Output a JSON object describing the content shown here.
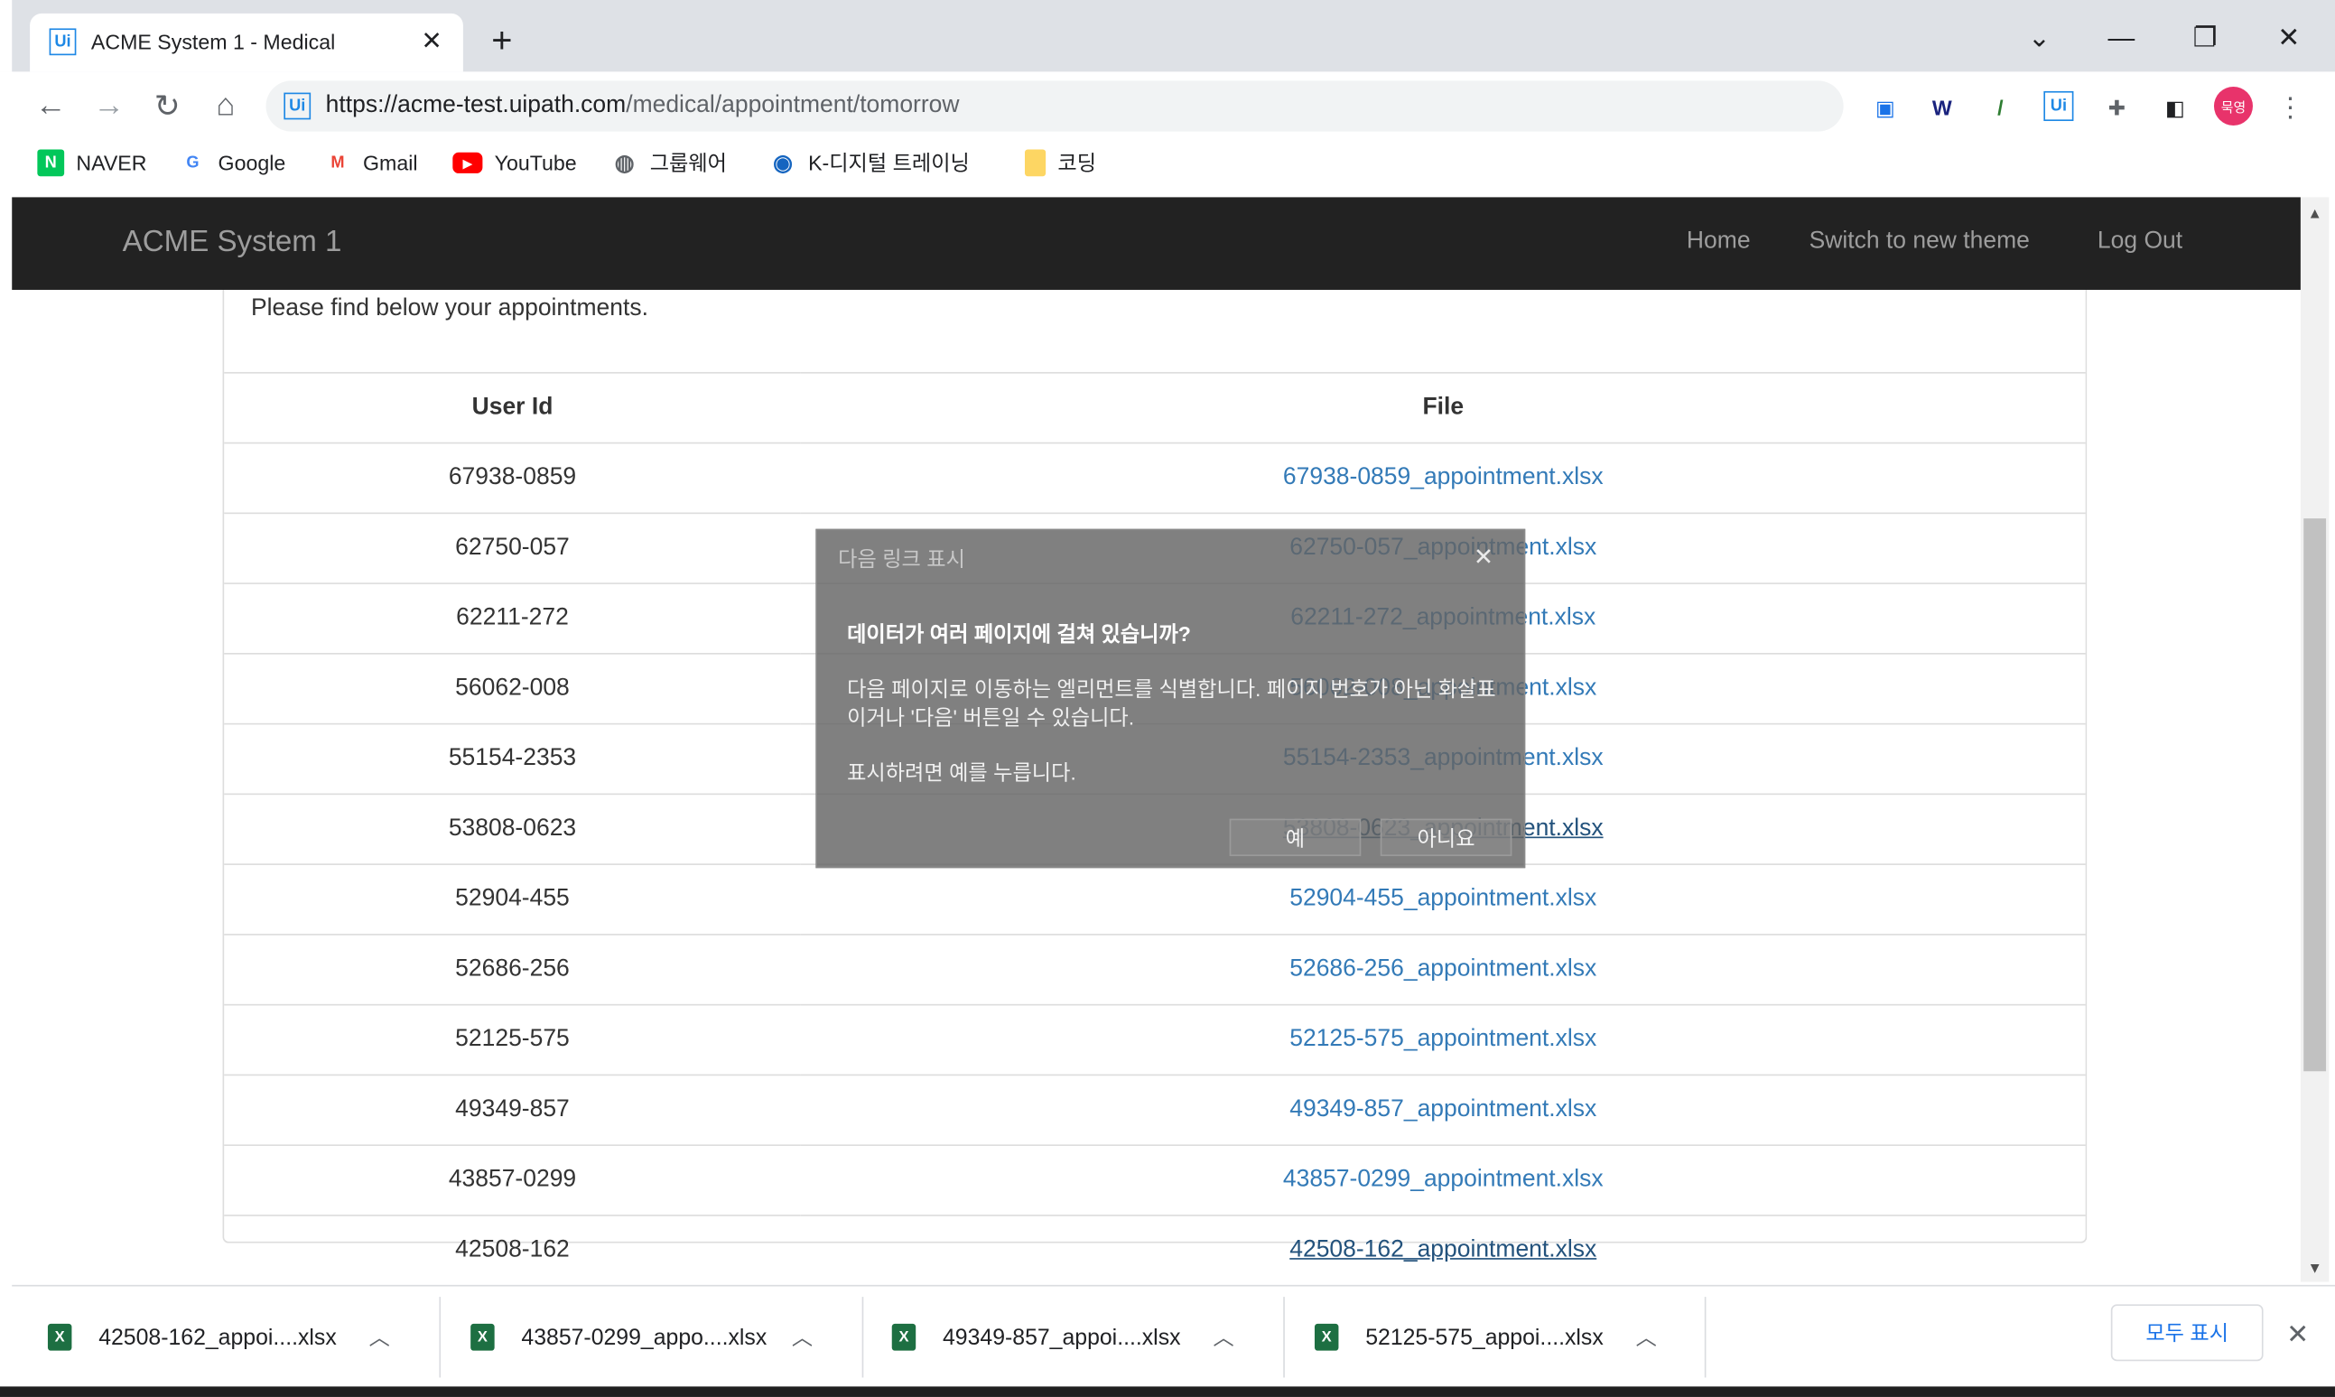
{
  "browser": {
    "tab_title": "ACME System 1 - Medical",
    "new_tab": "+",
    "url_host": "https://acme-test.uipath.com",
    "url_path": "/medical/appointment/tomorrow",
    "profile_label": "묵영",
    "bookmarks": [
      "NAVER",
      "Google",
      "Gmail",
      "YouTube",
      "그룹웨어",
      "K-디지털 트레이닝",
      "코딩"
    ]
  },
  "app": {
    "brand": "ACME System 1",
    "nav": [
      "Home",
      "Switch to new theme",
      "Log Out"
    ],
    "intro": "Please find below your appointments.",
    "table": {
      "headers": [
        "User Id",
        "File"
      ],
      "rows": [
        {
          "id": "67938-0859",
          "file": "67938-0859_appointment.xlsx"
        },
        {
          "id": "62750-057",
          "file": "62750-057_appointment.xlsx"
        },
        {
          "id": "62211-272",
          "file": "62211-272_appointment.xlsx"
        },
        {
          "id": "56062-008",
          "file": "56062-008_appointment.xlsx"
        },
        {
          "id": "55154-2353",
          "file": "55154-2353_appointment.xlsx"
        },
        {
          "id": "53808-0623",
          "file": "53808-0623_appointment.xlsx"
        },
        {
          "id": "52904-455",
          "file": "52904-455_appointment.xlsx"
        },
        {
          "id": "52686-256",
          "file": "52686-256_appointment.xlsx"
        },
        {
          "id": "52125-575",
          "file": "52125-575_appointment.xlsx"
        },
        {
          "id": "49349-857",
          "file": "49349-857_appointment.xlsx"
        },
        {
          "id": "43857-0299",
          "file": "43857-0299_appointment.xlsx"
        },
        {
          "id": "42508-162",
          "file": "42508-162_appointment.xlsx"
        }
      ]
    }
  },
  "dialog": {
    "title": "다음 링크 표시",
    "question": "데이터가 여러 페이지에 걸쳐 있습니까?",
    "body1": "다음 페이지로 이동하는 엘리먼트를 식별합니다. 페이지 번호가 아닌 화살표이거나 '다음' 버튼일 수 있습니다.",
    "body2": "표시하려면 예를 누릅니다.",
    "yes": "예",
    "no": "아니요"
  },
  "downloads": {
    "items": [
      "42508-162_appoi....xlsx",
      "43857-0299_appo....xlsx",
      "49349-857_appoi....xlsx",
      "52125-575_appoi....xlsx"
    ],
    "show_all": "모두 표시"
  },
  "colors": {
    "navbar": "#222222",
    "link": "#337ab7",
    "chrome_bg": "#dee1e6"
  }
}
